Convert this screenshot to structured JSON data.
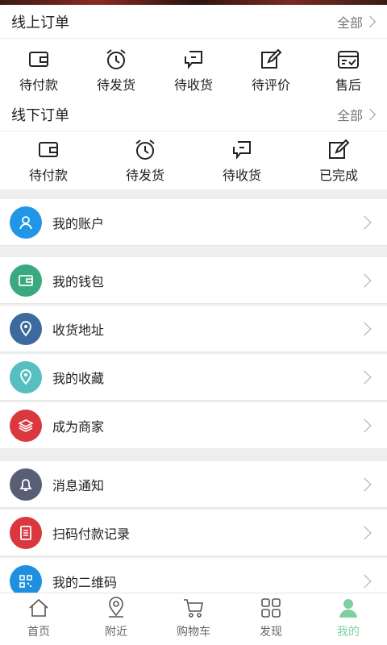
{
  "online_orders": {
    "title": "线上订单",
    "all_label": "全部",
    "items": [
      {
        "label": "待付款",
        "icon": "wallet-icon"
      },
      {
        "label": "待发货",
        "icon": "alarm-clock-icon"
      },
      {
        "label": "待收货",
        "icon": "delivery-icon"
      },
      {
        "label": "待评价",
        "icon": "edit-icon"
      },
      {
        "label": "售后",
        "icon": "after-sale-icon"
      }
    ]
  },
  "offline_orders": {
    "title": "线下订单",
    "all_label": "全部",
    "items": [
      {
        "label": "待付款",
        "icon": "wallet-icon"
      },
      {
        "label": "待发货",
        "icon": "alarm-clock-icon"
      },
      {
        "label": "待收货",
        "icon": "delivery-icon"
      },
      {
        "label": "已完成",
        "icon": "edit-icon"
      }
    ]
  },
  "menu": {
    "account": {
      "label": "我的账户",
      "icon": "user-icon",
      "color": "#2196e6"
    },
    "wallet": {
      "label": "我的钱包",
      "icon": "wallet-icon",
      "color": "#3aa97f"
    },
    "address": {
      "label": "收货地址",
      "icon": "location-pin-icon",
      "color": "#3c6a9c"
    },
    "favorites": {
      "label": "我的收藏",
      "icon": "location-pin-icon",
      "color": "#56bfc0"
    },
    "merchant": {
      "label": "成为商家",
      "icon": "layers-icon",
      "color": "#d9383f"
    },
    "notifications": {
      "label": "消息通知",
      "icon": "bell-icon",
      "color": "#585f75"
    },
    "scan_records": {
      "label": "扫码付款记录",
      "icon": "document-icon",
      "color": "#d9383f"
    },
    "qrcode": {
      "label": "我的二维码",
      "icon": "qrcode-icon",
      "color": "#1f8fe0"
    }
  },
  "tabbar": {
    "home": "首页",
    "nearby": "附近",
    "cart": "购物车",
    "discover": "发现",
    "mine": "我的",
    "active_color": "#7ed0a0"
  }
}
